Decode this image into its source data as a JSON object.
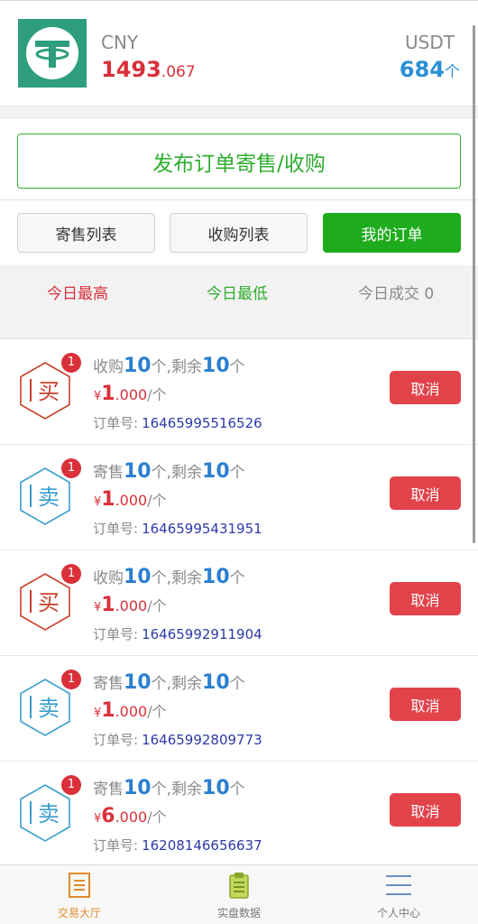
{
  "colors": {
    "red": "#d9303a",
    "green": "#1eac1e",
    "blue": "#2b7fd0",
    "order_id": "#2d3aa8",
    "buy_icon": "#c8402a",
    "sell_icon": "#3a9ed0",
    "nav_active": "#e08a2a"
  },
  "header": {
    "logo_icon": "tether-icon",
    "cny_label": "CNY",
    "cny_int": "1493",
    "cny_dec": ".067",
    "usdt_label": "USDT",
    "usdt_value": "684",
    "usdt_unit": "个"
  },
  "publish_button": "发布订单寄售/收购",
  "tabs": [
    {
      "label": "寄售列表",
      "active": false
    },
    {
      "label": "收购列表",
      "active": false
    },
    {
      "label": "我的订单",
      "active": true
    }
  ],
  "stats": {
    "high": "今日最高",
    "low": "今日最低",
    "volume": "今日成交 0"
  },
  "orders": [
    {
      "icon_char": "买",
      "icon_type": "buy",
      "badge": "1",
      "action": "收购",
      "qty": "10",
      "sep": "个,剩余",
      "remain": "10",
      "unit": "个",
      "currency": "¥",
      "price_int": "1",
      "price_dec": ".000",
      "price_unit": "/个",
      "id_label": "订单号:",
      "order_id": "16465995516526",
      "cancel": "取消"
    },
    {
      "icon_char": "卖",
      "icon_type": "sell",
      "badge": "1",
      "action": "寄售",
      "qty": "10",
      "sep": "个,剩余",
      "remain": "10",
      "unit": "个",
      "currency": "¥",
      "price_int": "1",
      "price_dec": ".000",
      "price_unit": "/个",
      "id_label": "订单号:",
      "order_id": "16465995431951",
      "cancel": "取消"
    },
    {
      "icon_char": "买",
      "icon_type": "buy",
      "badge": "1",
      "action": "收购",
      "qty": "10",
      "sep": "个,剩余",
      "remain": "10",
      "unit": "个",
      "currency": "¥",
      "price_int": "1",
      "price_dec": ".000",
      "price_unit": "/个",
      "id_label": "订单号:",
      "order_id": "16465992911904",
      "cancel": "取消"
    },
    {
      "icon_char": "卖",
      "icon_type": "sell",
      "badge": "1",
      "action": "寄售",
      "qty": "10",
      "sep": "个,剩余",
      "remain": "10",
      "unit": "个",
      "currency": "¥",
      "price_int": "1",
      "price_dec": ".000",
      "price_unit": "/个",
      "id_label": "订单号:",
      "order_id": "16465992809773",
      "cancel": "取消"
    },
    {
      "icon_char": "卖",
      "icon_type": "sell",
      "badge": "1",
      "action": "寄售",
      "qty": "10",
      "sep": "个,剩余",
      "remain": "10",
      "unit": "个",
      "currency": "¥",
      "price_int": "6",
      "price_dec": ".000",
      "price_unit": "/个",
      "id_label": "订单号:",
      "order_id": "16208146656637",
      "cancel": "取消"
    }
  ],
  "nav": [
    {
      "label": "交易大厅",
      "icon": "document-icon",
      "active": true
    },
    {
      "label": "实盘数据",
      "icon": "clipboard-icon",
      "active": false
    },
    {
      "label": "个人中心",
      "icon": "menu-icon",
      "active": false
    }
  ]
}
